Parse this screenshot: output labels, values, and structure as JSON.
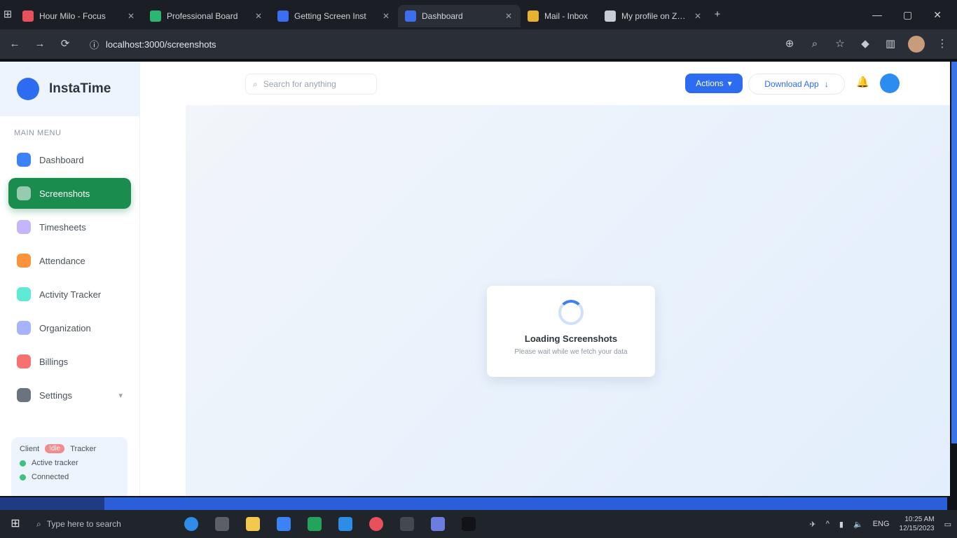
{
  "browser": {
    "tabs": [
      {
        "title": "Hour Milo - Focus",
        "color": "#e8505b"
      },
      {
        "title": "Professional Board",
        "color": "#2bb673"
      },
      {
        "title": "Getting Screen Inst",
        "color": "#3b6ff0"
      },
      {
        "title": "Dashboard",
        "color": "#3b6ff0"
      },
      {
        "title": "Mail - Inbox",
        "color": "#e8b12e"
      },
      {
        "title": "My profile on Zaigns",
        "color": "#c8cdd3"
      }
    ],
    "address": "localhost:3000/screenshots"
  },
  "app": {
    "brand": "InstaTime",
    "section_label": "MAIN MENU",
    "nav": [
      {
        "label": "Dashboard",
        "color": "#3b82f6"
      },
      {
        "label": "Screenshots",
        "color": "#ffffff"
      },
      {
        "label": "Timesheets",
        "color": "#c4b5fd"
      },
      {
        "label": "Attendance",
        "color": "#fb923c"
      },
      {
        "label": "Activity Tracker",
        "color": "#5eead4"
      },
      {
        "label": "Organization",
        "color": "#a5b4fc"
      },
      {
        "label": "Billings",
        "color": "#f87171"
      },
      {
        "label": "Settings",
        "color": "#6b7280"
      }
    ],
    "status": {
      "title": "Client",
      "badge": "Idle",
      "label": "Tracker",
      "items": [
        "Active tracker",
        "Connected"
      ]
    },
    "search_placeholder": "Search for anything",
    "primary_button": "Actions",
    "outline_button": "Download App",
    "loading": {
      "title": "Loading Screenshots",
      "subtitle": "Please wait while we fetch your data"
    }
  },
  "progress_fraction": 0.11,
  "taskbar": {
    "search_placeholder": "Type here to search",
    "apps": [
      {
        "name": "edge",
        "color": "#2f8ce8"
      },
      {
        "name": "task-view",
        "color": "#5c5f66"
      },
      {
        "name": "file-explorer",
        "color": "#f2c94c"
      },
      {
        "name": "store",
        "color": "#3b82f6"
      },
      {
        "name": "spreadsheet",
        "color": "#22a55b"
      },
      {
        "name": "code",
        "color": "#2b8de6"
      },
      {
        "name": "chrome",
        "color": "#e8505b"
      },
      {
        "name": "terminal",
        "color": "#444851"
      },
      {
        "name": "app-blue",
        "color": "#6b7de0"
      },
      {
        "name": "app-dark",
        "color": "#111318"
      }
    ],
    "time": "10:25 AM",
    "date": "12/15/2023",
    "language": "ENG"
  }
}
